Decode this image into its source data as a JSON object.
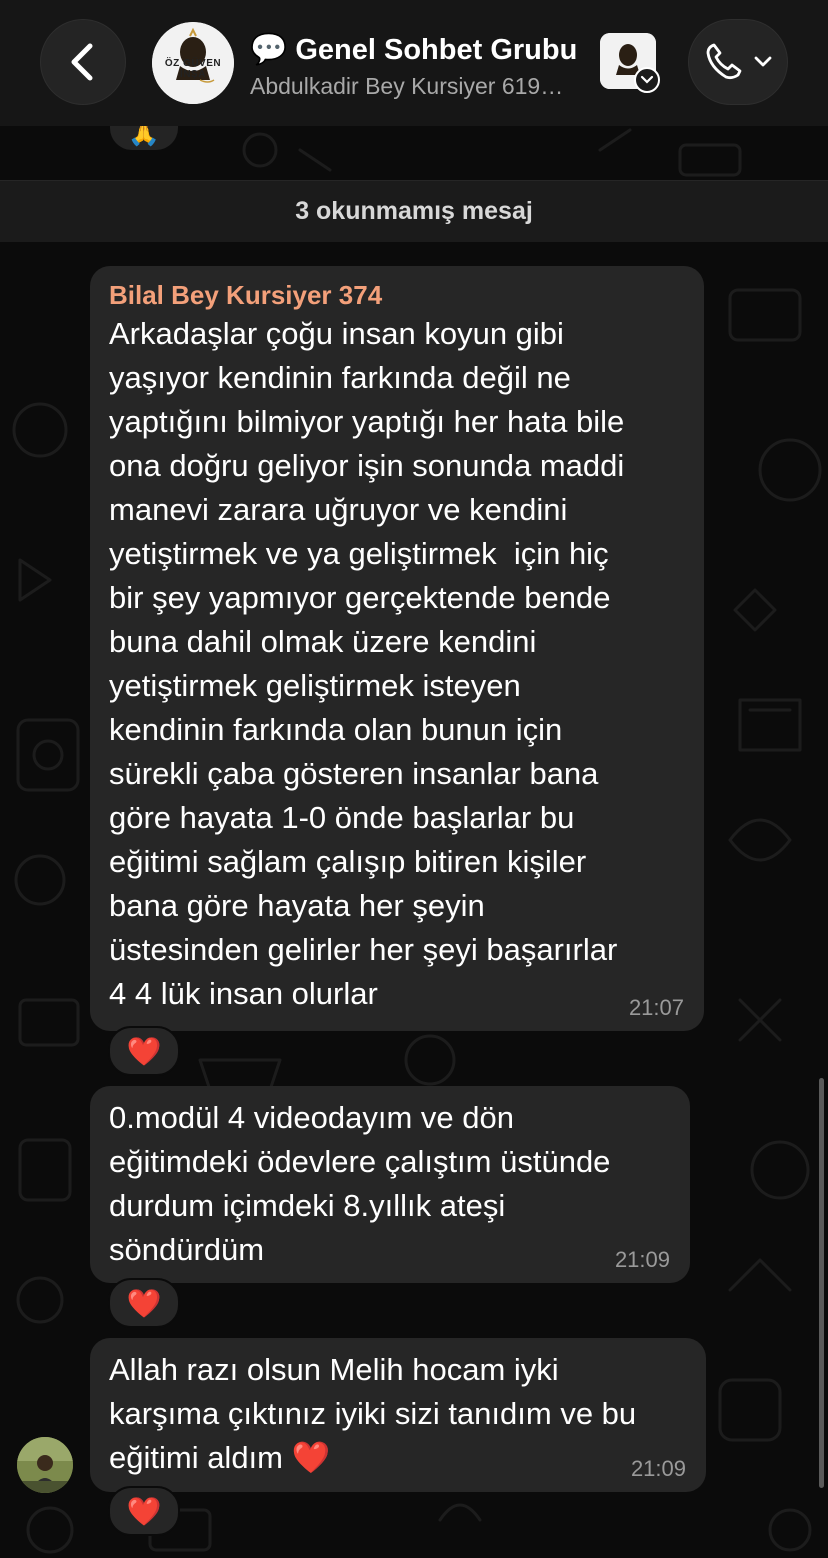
{
  "header": {
    "title_emoji": "💬",
    "title": "Genel Sohbet Grubu",
    "subtitle": "Abdulkadir Bey Kursiyer 619…",
    "avatar_text": "ÖZ GÜVEN İNŞA"
  },
  "previous_reaction": "🙏",
  "unread_divider": "3 okunmamış mesaj",
  "messages": [
    {
      "sender": "Bilal Bey Kursiyer 374",
      "text": "Arkadaşlar çoğu insan koyun gibi\nyaşıyor kendinin farkında değil ne\nyaptığını bilmiyor yaptığı her hata bile\nona doğru geliyor işin sonunda maddi\nmanevi zarara uğruyor ve kendini\nyetiştirmek ve ya geliştirmek  için hiç\nbir şey yapmıyor gerçektende bende\nbuna dahil olmak üzere kendini\nyetiştirmek geliştirmek isteyen\nkendinin farkında olan bunun için\nsürekli çaba gösteren insanlar bana\ngöre hayata 1-0 önde başlarlar bu\neğitimi sağlam çalışıp bitiren kişiler\nbana göre hayata her şeyin\nüstesinden gelirler her şeyi başarırlar\n4 4 lük insan olurlar",
      "time": "21:07",
      "reaction": "❤️"
    },
    {
      "text": "0.modül 4 videodayım ve dön\neğitimdeki ödevlere çalıştım üstünde\ndurdum içimdeki 8.yıllık ateşi\nsöndürdüm",
      "time": "21:09",
      "reaction": "❤️"
    },
    {
      "text": "Allah razı olsun Melih hocam iyki\nkarşıma çıktınız iyiki sizi tanıdım ve bu\neğitimi aldım ❤️",
      "time": "21:09",
      "reaction": "❤️"
    }
  ],
  "colors": {
    "background": "#0b0b0b",
    "bubble": "#262626",
    "sender_name": "#f3a07a",
    "time": "#9a9a9a"
  }
}
